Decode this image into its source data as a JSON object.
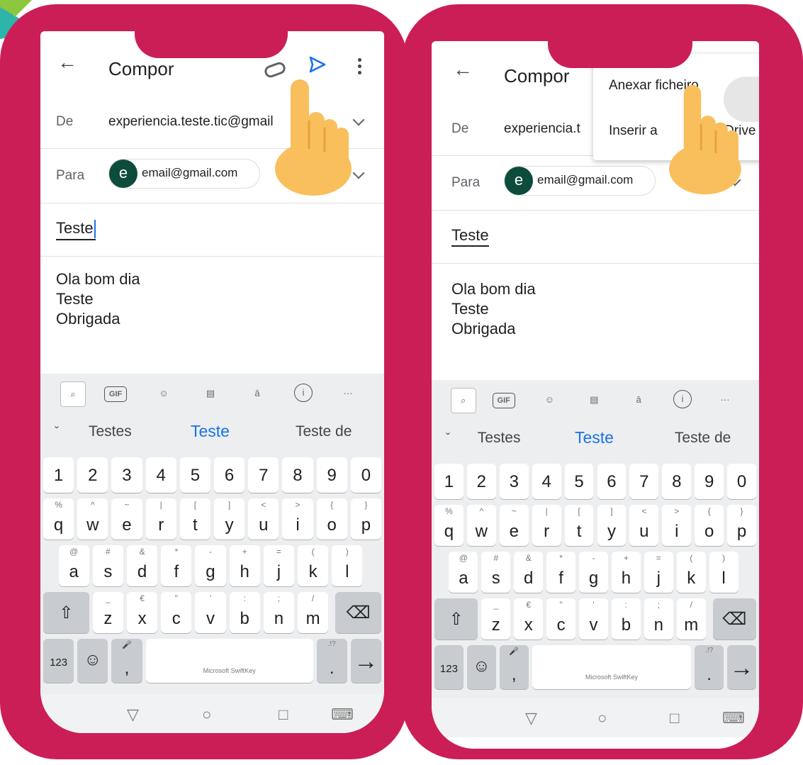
{
  "screens": [
    {
      "app_bar": {
        "back_icon": "arrow-left-icon",
        "title": "Compor",
        "attach_icon": "paperclip-icon",
        "send_icon": "send-icon",
        "more_icon": "more-vert-icon"
      },
      "from": {
        "label": "De",
        "value": "experiencia.teste.tic@gmail"
      },
      "to": {
        "label": "Para",
        "avatar_letter": "e",
        "chip_text": "email@gmail.com"
      },
      "subject": "Teste",
      "body_lines": [
        "Ola bom dia",
        "Teste",
        "Obrigada"
      ]
    },
    {
      "app_bar": {
        "back_icon": "arrow-left-icon",
        "title": "Compor"
      },
      "from": {
        "label": "De",
        "value": "experiencia.t"
      },
      "to": {
        "label": "Para",
        "avatar_letter": "e",
        "chip_text": "email@gmail.com"
      },
      "subject": "Teste",
      "body_lines": [
        "Ola bom dia",
        "Teste",
        "Obrigada"
      ],
      "menu": {
        "items": [
          "Anexar ficheiro",
          "Inserir a",
          "do Drive"
        ]
      }
    }
  ],
  "keyboard": {
    "toolbar_icons": [
      "search-icon",
      "gif-icon",
      "sticker-icon",
      "clipboard-icon",
      "translate-icon",
      "info-icon",
      "more-horiz-icon"
    ],
    "gif_label": "GIF",
    "info_label": "i",
    "more_label": "···",
    "collapse_label": "ˇ",
    "suggestions": [
      "Testes",
      "Teste",
      "Teste de"
    ],
    "numbers": [
      "1",
      "2",
      "3",
      "4",
      "5",
      "6",
      "7",
      "8",
      "9",
      "0"
    ],
    "row1": {
      "keys": [
        "q",
        "w",
        "e",
        "r",
        "t",
        "y",
        "u",
        "i",
        "o",
        "p"
      ],
      "secondary": [
        "%",
        "^",
        "~",
        "|",
        "[",
        "]",
        "<",
        ">",
        "{",
        "}"
      ]
    },
    "row2": {
      "keys": [
        "a",
        "s",
        "d",
        "f",
        "g",
        "h",
        "j",
        "k",
        "l"
      ],
      "secondary": [
        "@",
        "#",
        "&",
        "*",
        "-",
        "+",
        "=",
        "(",
        ")"
      ]
    },
    "row3": {
      "keys": [
        "z",
        "x",
        "c",
        "v",
        "b",
        "n",
        "m"
      ],
      "secondary": [
        "_",
        "€",
        "\"",
        "'",
        ":",
        ";",
        "/"
      ]
    },
    "shift_label": "⇧",
    "backspace_label": "⌫",
    "num_label": "123",
    "emoji_label": "☺",
    "comma_label": ",",
    "mic_label": "🎤",
    "space_label": "Microsoft SwiftKey",
    "period_label": ".",
    "period_secondary": ".!?",
    "enter_label": "→",
    "nav": {
      "back": "▽",
      "home": "○",
      "recents": "□",
      "keyboard": "⌨"
    }
  },
  "colors": {
    "frame": "#cb1e57",
    "send_blue": "#1a73e8",
    "avatar": "#0d4b3c",
    "hand": "#f9bf5c"
  }
}
